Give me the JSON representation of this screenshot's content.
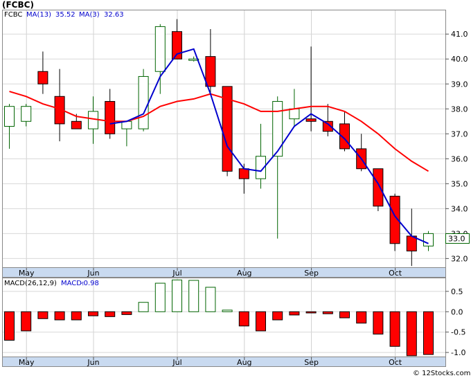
{
  "header": {
    "title": "(FCBC)"
  },
  "legend": {
    "symbol": "FCBC",
    "ma13_label": "MA(13)",
    "ma13_value": "35.52",
    "ma3_label": "MA(3)",
    "ma3_value": "32.63",
    "macd_params": "MACD(26,12,9)",
    "macd_label": "MACD:",
    "macd_value": "-0.98"
  },
  "last_price_label": "33.0",
  "credit": "© 12Stocks.com",
  "colors": {
    "up": "#006400",
    "down": "#ff0000",
    "ma13": "#ff0000",
    "ma3": "#0000cd",
    "axis_band": "#c9daf0",
    "bg": "#ffffff"
  },
  "chart_data": [
    {
      "type": "candlestick",
      "x_labels": [
        "May",
        "Jun",
        "Jul",
        "Aug",
        "Sep",
        "Oct"
      ],
      "x_label_week_index": [
        1,
        5,
        10,
        14,
        18,
        23
      ],
      "y_ticks": [
        32.0,
        33.0,
        34.0,
        35.0,
        36.0,
        37.0,
        38.0,
        39.0,
        40.0,
        41.0
      ],
      "ylim": [
        31.65,
        41.95
      ],
      "candles": [
        {
          "o": 37.3,
          "h": 38.2,
          "l": 36.4,
          "c": 38.1
        },
        {
          "o": 37.5,
          "h": 38.2,
          "l": 37.3,
          "c": 38.1
        },
        {
          "o": 39.5,
          "h": 40.3,
          "l": 38.6,
          "c": 39.0
        },
        {
          "o": 38.5,
          "h": 39.6,
          "l": 36.7,
          "c": 37.4
        },
        {
          "o": 37.5,
          "h": 37.8,
          "l": 37.2,
          "c": 37.2
        },
        {
          "o": 37.2,
          "h": 38.5,
          "l": 36.6,
          "c": 37.9
        },
        {
          "o": 38.3,
          "h": 38.8,
          "l": 36.8,
          "c": 37.0
        },
        {
          "o": 37.2,
          "h": 37.5,
          "l": 36.5,
          "c": 37.5
        },
        {
          "o": 37.2,
          "h": 39.6,
          "l": 37.1,
          "c": 39.3
        },
        {
          "o": 39.5,
          "h": 41.4,
          "l": 38.6,
          "c": 41.3
        },
        {
          "o": 41.1,
          "h": 41.6,
          "l": 40.2,
          "c": 40.0
        },
        {
          "o": 40.0,
          "h": 40.1,
          "l": 39.9,
          "c": 40.0
        },
        {
          "o": 40.1,
          "h": 41.2,
          "l": 38.6,
          "c": 38.9
        },
        {
          "o": 38.9,
          "h": 38.9,
          "l": 35.3,
          "c": 35.5
        },
        {
          "o": 35.6,
          "h": 35.8,
          "l": 34.6,
          "c": 35.2
        },
        {
          "o": 35.2,
          "h": 37.4,
          "l": 34.8,
          "c": 36.1
        },
        {
          "o": 36.1,
          "h": 38.5,
          "l": 32.8,
          "c": 38.3
        },
        {
          "o": 37.6,
          "h": 38.8,
          "l": 37.3,
          "c": 38.0
        },
        {
          "o": 37.6,
          "h": 40.5,
          "l": 37.1,
          "c": 37.5
        },
        {
          "o": 37.5,
          "h": 38.2,
          "l": 36.9,
          "c": 37.1
        },
        {
          "o": 37.4,
          "h": 37.9,
          "l": 36.3,
          "c": 36.4
        },
        {
          "o": 36.4,
          "h": 37.0,
          "l": 35.5,
          "c": 35.6
        },
        {
          "o": 35.6,
          "h": 35.6,
          "l": 33.9,
          "c": 34.1
        },
        {
          "o": 34.5,
          "h": 34.6,
          "l": 32.3,
          "c": 32.6
        },
        {
          "o": 32.9,
          "h": 34.0,
          "l": 31.7,
          "c": 32.3
        },
        {
          "o": 32.5,
          "h": 33.1,
          "l": 32.3,
          "c": 33.0
        }
      ],
      "series": [
        {
          "name": "MA(13)",
          "color": "#ff0000",
          "values": [
            38.6,
            38.3,
            38.1,
            37.9,
            37.6,
            37.5,
            37.4,
            37.4,
            null,
            null,
            null,
            40.3,
            39.0,
            38.3,
            36.5,
            35.3,
            36.8,
            37.5,
            37.8,
            37.4,
            37.1,
            36.6,
            36.1,
            34.7,
            33.2,
            32.6
          ]
        },
        {
          "name": "MA(3)",
          "color": "#0000cd",
          "values": [
            null,
            null,
            null,
            null,
            null,
            null,
            37.4,
            37.4,
            37.8,
            39.4,
            40.2,
            40.4,
            38.6,
            null,
            null,
            35.6,
            36.2,
            37.3,
            37.8,
            37.1,
            36.5,
            35.5,
            34.5,
            33.3,
            32.6,
            32.6
          ]
        }
      ],
      "ma13_line": [
        38.7,
        38.5,
        38.2,
        38.0,
        37.7,
        37.6,
        37.5,
        37.5,
        37.7,
        38.1,
        38.3,
        38.4,
        38.6,
        38.4,
        38.2,
        37.9,
        37.9,
        38.0,
        38.1,
        38.1,
        37.9,
        37.5,
        37.0,
        36.4,
        35.9,
        35.5
      ],
      "ma3_line": [
        null,
        null,
        null,
        null,
        null,
        null,
        37.4,
        37.5,
        37.8,
        39.3,
        40.2,
        40.4,
        38.6,
        36.5,
        35.6,
        35.5,
        36.3,
        37.3,
        37.8,
        37.4,
        36.8,
        36.0,
        35.0,
        33.7,
        32.9,
        32.6
      ],
      "ma_series_names": [
        "MA(13)",
        "MA(3)"
      ]
    },
    {
      "type": "bar",
      "name": "MACD(26,12,9)",
      "y_ticks": [
        0.5,
        0.0,
        -0.5,
        -1.0
      ],
      "y_tick_labels": [
        "0.5",
        "0.0",
        "-0.5",
        "-1.0"
      ],
      "ylim": [
        -1.1,
        0.82
      ],
      "values": [
        -0.7,
        -0.47,
        -0.17,
        -0.2,
        -0.2,
        -0.1,
        -0.12,
        -0.07,
        0.23,
        0.7,
        0.78,
        0.77,
        0.6,
        0.04,
        -0.35,
        -0.47,
        -0.2,
        -0.08,
        -0.03,
        -0.05,
        -0.15,
        -0.28,
        -0.55,
        -0.85,
        -1.08,
        -1.05
      ]
    }
  ]
}
